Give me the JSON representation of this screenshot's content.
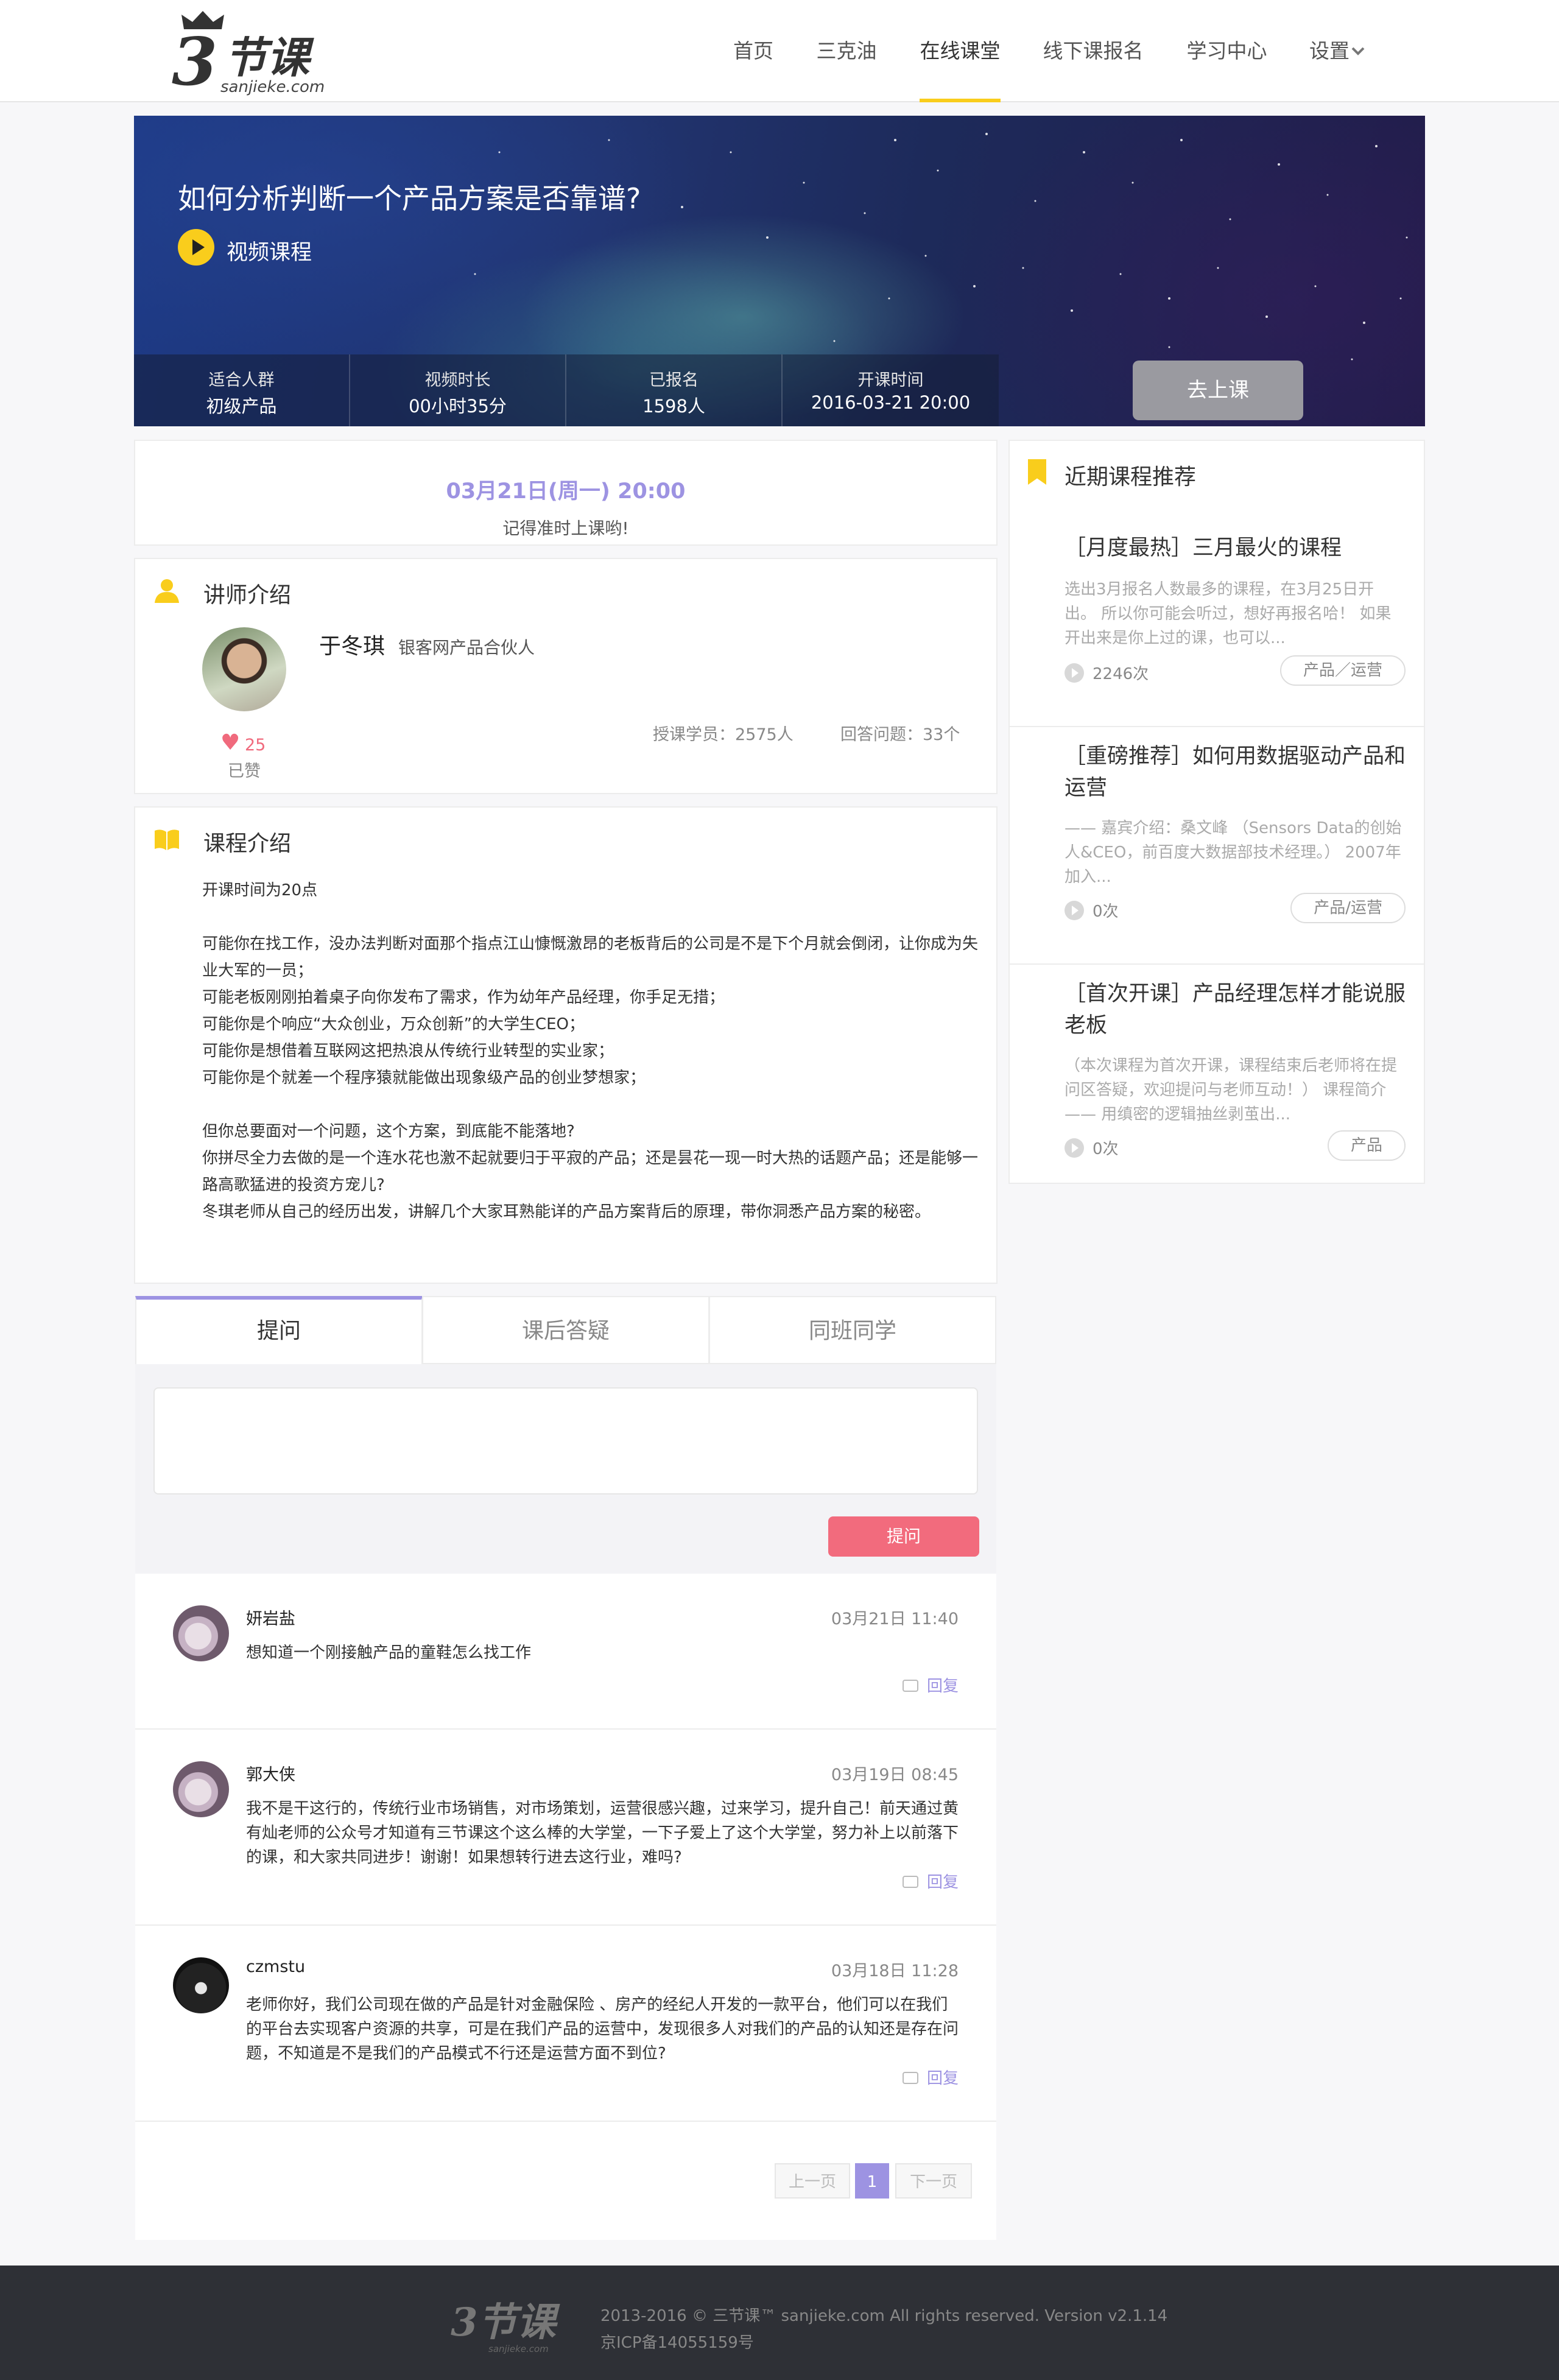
{
  "brand": {
    "logo_number": "3",
    "logo_text": "节课",
    "domain": "sanjieke.com"
  },
  "nav": {
    "items": [
      "首页",
      "三克油",
      "在线课堂",
      "线下课报名",
      "学习中心",
      "设置"
    ],
    "active": "在线课堂"
  },
  "hero": {
    "title": "如何分析判断一个产品方案是否靠谱?",
    "type": "视频课程",
    "stats": [
      {
        "label": "适合人群",
        "value": "初级产品"
      },
      {
        "label": "视频时长",
        "value": "00小时35分"
      },
      {
        "label": "已报名",
        "value": "1598人"
      },
      {
        "label": "开课时间",
        "value": "2016-03-21 20:00"
      }
    ],
    "button": "去上课"
  },
  "schedule": {
    "date": "03月21日(周一)  20:00",
    "note": "记得准时上课哟!"
  },
  "teacher": {
    "section_title": "讲师介绍",
    "name": "于冬琪",
    "role": "银客网产品合伙人",
    "likes": "25",
    "like_state": "已赞",
    "students": "授课学员：2575人",
    "answers": "回答问题：33个"
  },
  "intro": {
    "section_title": "课程介绍",
    "paragraphs": [
      "开课时间为20点",
      "",
      "可能你在找工作，没办法判断对面那个指点江山慷慨激昂的老板背后的公司是不是下个月就会倒闭，让你成为失业大军的一员；",
      "可能老板刚刚拍着桌子向你发布了需求，作为幼年产品经理，你手足无措；",
      "可能你是个响应“大众创业，万众创新”的大学生CEO；",
      "可能你是想借着互联网这把热浪从传统行业转型的实业家；",
      "可能你是个就差一个程序猿就能做出现象级产品的创业梦想家；",
      "",
      "但你总要面对一个问题，这个方案，到底能不能落地?",
      "你拼尽全力去做的是一个连水花也激不起就要归于平寂的产品；还是昙花一现一时大热的话题产品；还是能够一路高歌猛进的投资方宠儿?",
      "冬琪老师从自己的经历出发，讲解几个大家耳熟能详的产品方案背后的原理，带你洞悉产品方案的秘密。"
    ]
  },
  "tabs": [
    "提问",
    "课后答疑",
    "同班同学"
  ],
  "ask_button": "提问",
  "questions": [
    {
      "user": "妍岩盐",
      "time": "03月21日 11:40",
      "text": "想知道一个刚接触产品的童鞋怎么找工作",
      "reply": "回复"
    },
    {
      "user": "郭大侠",
      "time": "03月19日 08:45",
      "text": "我不是干这行的，传统行业市场销售，对市场策划，运营很感兴趣，过来学习，提升自己！前天通过黄有灿老师的公众号才知道有三节课这个这么棒的大学堂，一下子爱上了这个大学堂，努力补上以前落下的课，和大家共同进步！谢谢！如果想转行进去这行业，难吗?",
      "reply": "回复"
    },
    {
      "user": "czmstu",
      "time": "03月18日 11:28",
      "text": "老师你好，我们公司现在做的产品是针对金融保险 、房产的经纪人开发的一款平台，他们可以在我们的平台去实现客户资源的共享，可是在我们产品的运营中，发现很多人对我们的产品的认知还是存在问题，不知道是不是我们的产品模式不行还是运营方面不到位?",
      "reply": "回复"
    }
  ],
  "pager": {
    "prev": "上一页",
    "current": "1",
    "next": "下一页"
  },
  "sidebar": {
    "title": "近期课程推荐",
    "items": [
      {
        "title": "［月度最热］三月最火的课程",
        "desc": "选出3月报名人数最多的课程，在3月25日开出。 所以你可能会听过，想好再报名哈！ 如果开出来是你上过的课，也可以...",
        "views": "2246次",
        "tag": "产品／运营"
      },
      {
        "title": "［重磅推荐］如何用数据驱动产品和运营",
        "desc": "—— 嘉宾介绍：桑文峰 （Sensors Data的创始人&CEO，前百度大数据部技术经理。） 2007年加入...",
        "views": "0次",
        "tag": "产品/运营"
      },
      {
        "title": "［首次开课］产品经理怎样才能说服老板",
        "desc": "（本次课程为首次开课，课程结束后老师将在提问区答疑，欢迎提问与老师互动！） 课程简介 —— 用缜密的逻辑抽丝剥茧出...",
        "views": "0次",
        "tag": "产品"
      }
    ]
  },
  "footer": {
    "copyright": "2013-2016 © 三节课™ sanjieke.com All rights reserved. Version v2.1.14",
    "icp": "京ICP备14055159号"
  },
  "colors": {
    "accent_yellow": "#f9cd1c",
    "accent_purple": "#9d93e2",
    "accent_pink": "#f26b7d"
  }
}
